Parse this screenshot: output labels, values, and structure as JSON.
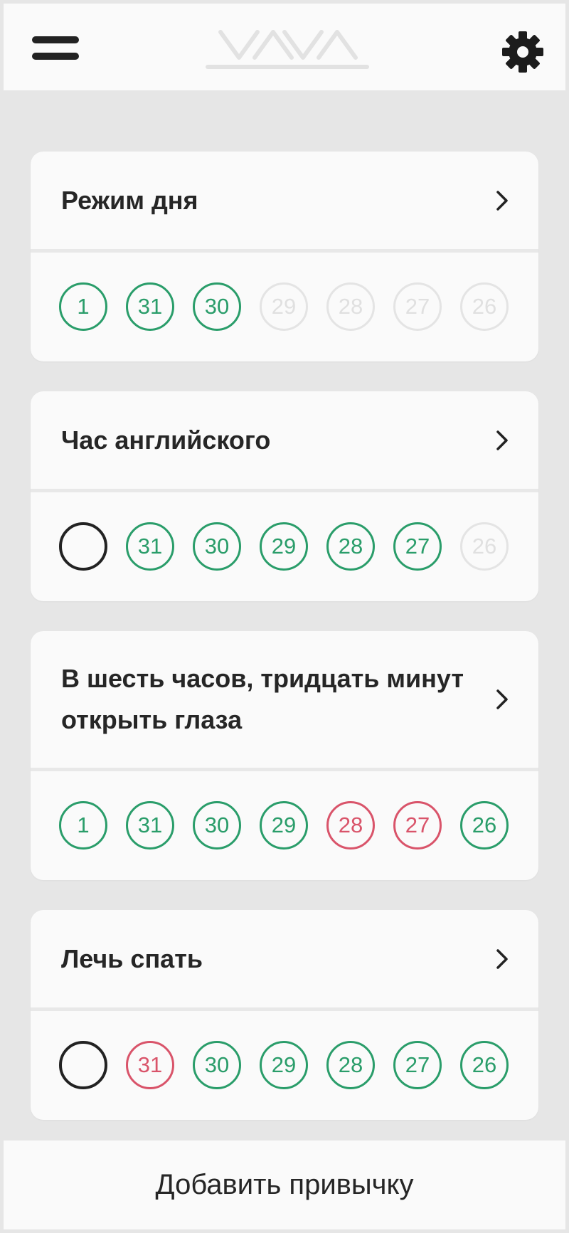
{
  "header": {
    "menu_icon": "hamburger-menu-icon",
    "logo_icon": "app-logo",
    "settings_icon": "gear-icon"
  },
  "colors": {
    "done": "#2a9d6a",
    "missed": "#d9546a",
    "inactive": "#e4e4e4",
    "today": "#222222",
    "background": "#e6e6e6",
    "card": "#fafafa"
  },
  "habits": [
    {
      "title": "Режим дня",
      "days": [
        {
          "label": "1",
          "status": "done"
        },
        {
          "label": "31",
          "status": "done"
        },
        {
          "label": "30",
          "status": "done"
        },
        {
          "label": "29",
          "status": "inactive"
        },
        {
          "label": "28",
          "status": "inactive"
        },
        {
          "label": "27",
          "status": "inactive"
        },
        {
          "label": "26",
          "status": "inactive"
        }
      ]
    },
    {
      "title": "Час английского",
      "days": [
        {
          "label": "",
          "status": "today"
        },
        {
          "label": "31",
          "status": "done"
        },
        {
          "label": "30",
          "status": "done"
        },
        {
          "label": "29",
          "status": "done"
        },
        {
          "label": "28",
          "status": "done"
        },
        {
          "label": "27",
          "status": "done"
        },
        {
          "label": "26",
          "status": "inactive"
        }
      ]
    },
    {
      "title": "В шесть часов, тридцать минут открыть глаза",
      "days": [
        {
          "label": "1",
          "status": "done"
        },
        {
          "label": "31",
          "status": "done"
        },
        {
          "label": "30",
          "status": "done"
        },
        {
          "label": "29",
          "status": "done"
        },
        {
          "label": "28",
          "status": "missed"
        },
        {
          "label": "27",
          "status": "missed"
        },
        {
          "label": "26",
          "status": "done"
        }
      ]
    },
    {
      "title": "Лечь спать",
      "days": [
        {
          "label": "",
          "status": "today"
        },
        {
          "label": "31",
          "status": "missed"
        },
        {
          "label": "30",
          "status": "done"
        },
        {
          "label": "29",
          "status": "done"
        },
        {
          "label": "28",
          "status": "done"
        },
        {
          "label": "27",
          "status": "done"
        },
        {
          "label": "26",
          "status": "done"
        }
      ]
    }
  ],
  "footer": {
    "add_button_label": "Добавить привычку"
  }
}
